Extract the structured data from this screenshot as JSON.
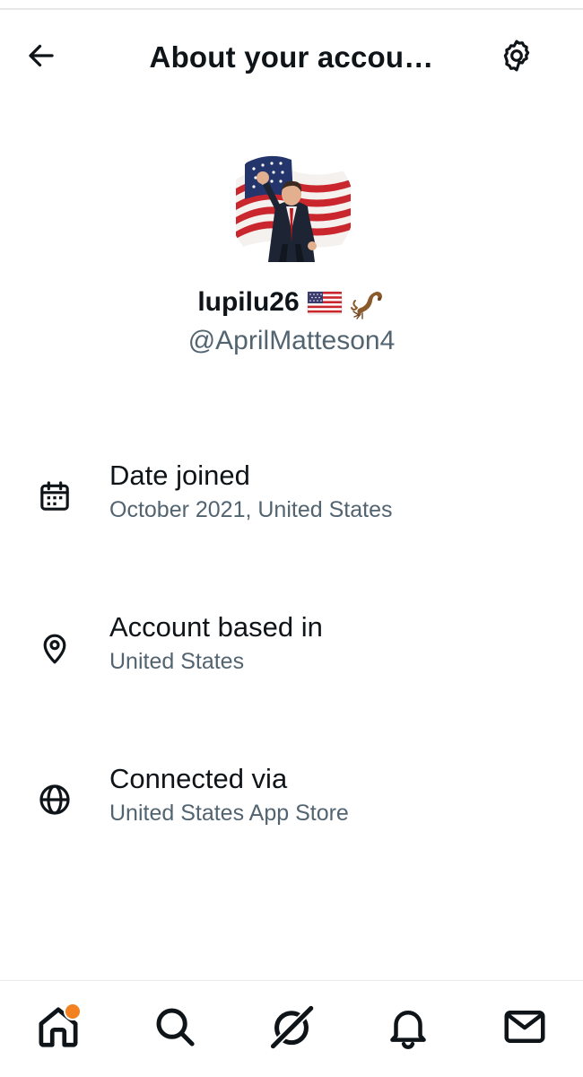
{
  "header": {
    "title": "About your accou…",
    "back_icon": "arrow-left-icon",
    "settings_icon": "gear-icon"
  },
  "profile": {
    "display_name": "lupilu26",
    "name_emojis": [
      "flag-usa",
      "scorpion"
    ],
    "handle": "@AprilMatteson4",
    "avatar_description": "man with raised fist in front of US flag"
  },
  "info": [
    {
      "icon": "calendar-icon",
      "title": "Date joined",
      "value": "October 2021, United States"
    },
    {
      "icon": "location-pin-icon",
      "title": "Account based in",
      "value": "United States"
    },
    {
      "icon": "globe-icon",
      "title": "Connected via",
      "value": "United States App Store"
    }
  ],
  "bottom_nav": {
    "items": [
      "home-icon",
      "search-icon",
      "grok-icon",
      "bell-icon",
      "mail-icon"
    ],
    "home_has_notification": true
  },
  "colors": {
    "text_primary": "#0f1419",
    "text_secondary": "#536471",
    "notification_dot": "#f4811f"
  }
}
